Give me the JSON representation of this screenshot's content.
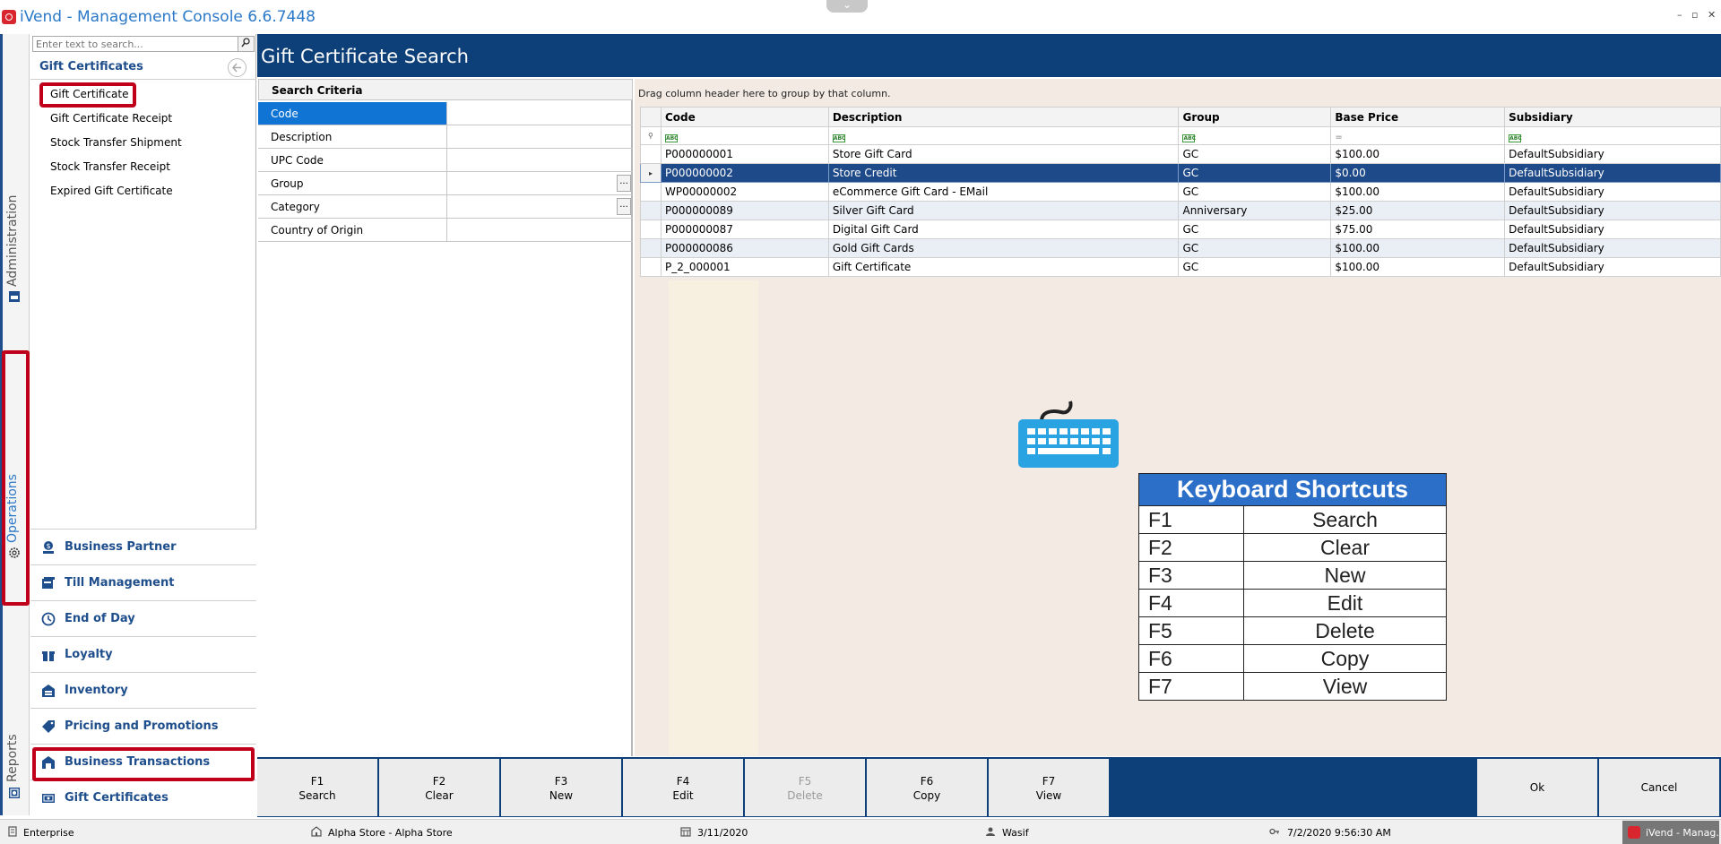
{
  "window": {
    "title": "iVend - Management Console  6.6.7448",
    "controls": [
      "–",
      "▫",
      "✕"
    ]
  },
  "rail": {
    "items": [
      {
        "label": "Administration",
        "icon": "administration-icon"
      },
      {
        "label": "Operations",
        "icon": "gear-icon",
        "active": true
      },
      {
        "label": "Reports",
        "icon": "reports-icon"
      }
    ]
  },
  "nav": {
    "search_placeholder": "Enter text to search...",
    "header": "Gift Certificates",
    "items": [
      {
        "label": "Gift Certificate",
        "selected": true
      },
      {
        "label": "Gift Certificate Receipt"
      },
      {
        "label": "Stock Transfer Shipment"
      },
      {
        "label": "Stock Transfer Receipt"
      },
      {
        "label": "Expired Gift Certificate"
      }
    ],
    "modules": [
      {
        "label": "Business Partner",
        "icon": "business-partner-icon"
      },
      {
        "label": "Till Management",
        "icon": "till-management-icon"
      },
      {
        "label": "End of Day",
        "icon": "clock-icon"
      },
      {
        "label": "Loyalty",
        "icon": "gift-icon"
      },
      {
        "label": "Inventory",
        "icon": "warehouse-icon"
      },
      {
        "label": "Pricing and Promotions",
        "icon": "price-tag-icon"
      },
      {
        "label": "Business Transactions",
        "icon": "transactions-icon"
      },
      {
        "label": "Gift Certificates",
        "icon": "gift-card-icon",
        "active": true
      }
    ]
  },
  "main": {
    "title": "Gift Certificate Search"
  },
  "criteria": {
    "header": "Search Criteria",
    "fields": [
      {
        "label": "Code",
        "value": "",
        "active": true
      },
      {
        "label": "Description",
        "value": ""
      },
      {
        "label": "UPC Code",
        "value": ""
      },
      {
        "label": "Group",
        "value": "",
        "lookup": true
      },
      {
        "label": "Category",
        "value": "",
        "lookup": true
      },
      {
        "label": "Country of Origin",
        "value": ""
      }
    ]
  },
  "grid": {
    "group_hint": "Drag column header here to group by that column.",
    "columns": [
      "Code",
      "Description",
      "Group",
      "Base Price",
      "Subsidiary"
    ],
    "filter_row": [
      "ABC",
      "ABC",
      "ABC",
      "=",
      "ABC"
    ],
    "rows": [
      [
        "P000000001",
        "Store Gift Card",
        "GC",
        "$100.00",
        "DefaultSubsidiary"
      ],
      [
        "P000000002",
        "Store Credit",
        "GC",
        "$0.00",
        "DefaultSubsidiary"
      ],
      [
        "WP00000002",
        "eCommerce Gift Card - EMail",
        "GC",
        "$100.00",
        "DefaultSubsidiary"
      ],
      [
        "P000000089",
        "Silver Gift Card",
        "Anniversary",
        "$25.00",
        "DefaultSubsidiary"
      ],
      [
        "P000000087",
        "Digital Gift Card",
        "GC",
        "$75.00",
        "DefaultSubsidiary"
      ],
      [
        "P000000086",
        "Gold Gift Cards",
        "GC",
        "$100.00",
        "DefaultSubsidiary"
      ],
      [
        "P_2_000001",
        "Gift Certificate",
        "GC",
        "$100.00",
        "DefaultSubsidiary"
      ]
    ],
    "selected_row": 1
  },
  "shortcuts": {
    "title": "Keyboard Shortcuts",
    "items": [
      {
        "key": "F1",
        "action": "Search"
      },
      {
        "key": "F2",
        "action": "Clear"
      },
      {
        "key": "F3",
        "action": "New"
      },
      {
        "key": "F4",
        "action": "Edit"
      },
      {
        "key": "F5",
        "action": "Delete"
      },
      {
        "key": "F6",
        "action": "Copy"
      },
      {
        "key": "F7",
        "action": "View"
      }
    ]
  },
  "toolbar": {
    "buttons": [
      {
        "key": "F1",
        "label": "Search"
      },
      {
        "key": "F2",
        "label": "Clear"
      },
      {
        "key": "F3",
        "label": "New"
      },
      {
        "key": "F4",
        "label": "Edit"
      },
      {
        "key": "F5",
        "label": "Delete",
        "disabled": true
      },
      {
        "key": "F6",
        "label": "Copy"
      },
      {
        "key": "F7",
        "label": "View"
      }
    ],
    "ok_label": "Ok",
    "cancel_label": "Cancel"
  },
  "status": {
    "edition": "Enterprise",
    "store": "Alpha Store - Alpha Store",
    "business_date": "3/11/2020",
    "user": "Wasif",
    "login_time": "7/2/2020 9:56:30 AM",
    "taskbar_label": "iVend - Manag..."
  },
  "colors": {
    "accent": "#0d3f78",
    "highlight": "#c0001a",
    "selection": "#1e4a8a",
    "active_field": "#0f74d4",
    "shortcut_header": "#2c6fc8"
  }
}
